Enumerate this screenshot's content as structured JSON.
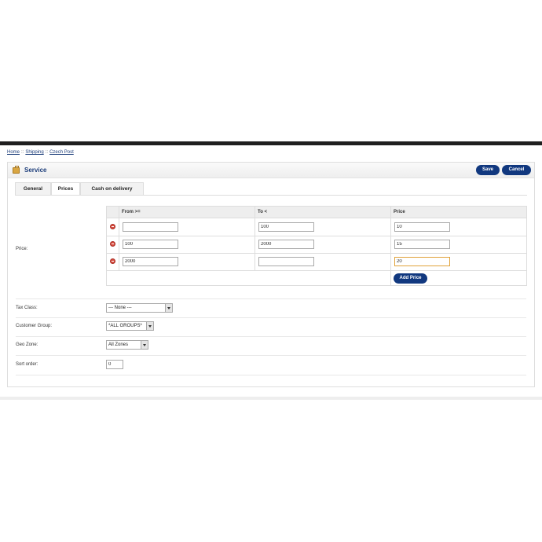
{
  "breadcrumb": {
    "items": [
      "Home",
      "Shipping",
      "Czech Post"
    ],
    "separator": "::"
  },
  "header": {
    "title": "Service",
    "save_label": "Save",
    "cancel_label": "Cancel"
  },
  "tabs": [
    {
      "label": "General",
      "active": false
    },
    {
      "label": "Prices",
      "active": true
    },
    {
      "label": "Cash on delivery",
      "active": false
    }
  ],
  "prices": {
    "label": "Price:",
    "columns": [
      "From >=",
      "To <",
      "Price"
    ],
    "rows": [
      {
        "from": "",
        "to": "100",
        "price": "10"
      },
      {
        "from": "100",
        "to": "2000",
        "price": "15"
      },
      {
        "from": "2000",
        "to": "",
        "price": "20"
      }
    ],
    "add_label": "Add Price"
  },
  "fields": {
    "tax_class": {
      "label": "Tax Class:",
      "value": "--- None ---"
    },
    "customer_group": {
      "label": "Customer Group:",
      "value": "*ALL GROUPS*"
    },
    "geo_zone": {
      "label": "Geo Zone:",
      "value": "All Zones"
    },
    "sort_order": {
      "label": "Sort order:",
      "value": "0"
    }
  },
  "colors": {
    "accent": "#11387f",
    "link": "#1c3d7a",
    "remove": "#d84b3f",
    "focus": "#e0a23a"
  }
}
